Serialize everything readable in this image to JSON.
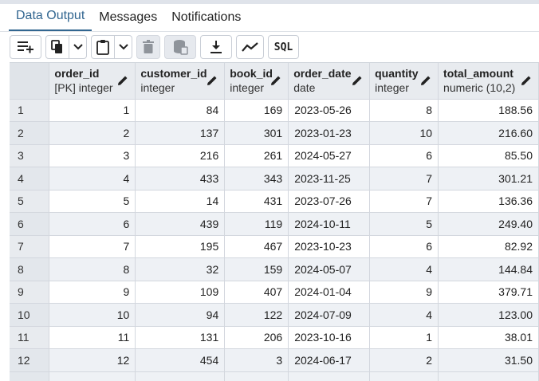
{
  "tabs": [
    {
      "label": "Data Output",
      "active": true
    },
    {
      "label": "Messages",
      "active": false
    },
    {
      "label": "Notifications",
      "active": false
    }
  ],
  "toolbar": {
    "sql_label": "SQL",
    "icons": [
      "add-row-icon",
      "copy-icon",
      "chevron-down-icon",
      "paste-icon",
      "chevron-down-icon",
      "delete-icon",
      "save-data-icon",
      "download-icon",
      "graph-icon",
      "sql-icon"
    ]
  },
  "columns": [
    {
      "name": "order_id",
      "type": "[PK] integer"
    },
    {
      "name": "customer_id",
      "type": "integer"
    },
    {
      "name": "book_id",
      "type": "integer"
    },
    {
      "name": "order_date",
      "type": "date"
    },
    {
      "name": "quantity",
      "type": "integer"
    },
    {
      "name": "total_amount",
      "type": "numeric (10,2)"
    }
  ],
  "rows": [
    {
      "rownum": "1",
      "cells": [
        "1",
        "84",
        "169",
        "2023-05-26",
        "8",
        "188.56"
      ]
    },
    {
      "rownum": "2",
      "cells": [
        "2",
        "137",
        "301",
        "2023-01-23",
        "10",
        "216.60"
      ]
    },
    {
      "rownum": "3",
      "cells": [
        "3",
        "216",
        "261",
        "2024-05-27",
        "6",
        "85.50"
      ]
    },
    {
      "rownum": "4",
      "cells": [
        "4",
        "433",
        "343",
        "2023-11-25",
        "7",
        "301.21"
      ]
    },
    {
      "rownum": "5",
      "cells": [
        "5",
        "14",
        "431",
        "2023-07-26",
        "7",
        "136.36"
      ]
    },
    {
      "rownum": "6",
      "cells": [
        "6",
        "439",
        "119",
        "2024-10-11",
        "5",
        "249.40"
      ]
    },
    {
      "rownum": "7",
      "cells": [
        "7",
        "195",
        "467",
        "2023-10-23",
        "6",
        "82.92"
      ]
    },
    {
      "rownum": "8",
      "cells": [
        "8",
        "32",
        "159",
        "2024-05-07",
        "4",
        "144.84"
      ]
    },
    {
      "rownum": "9",
      "cells": [
        "9",
        "109",
        "407",
        "2024-01-04",
        "9",
        "379.71"
      ]
    },
    {
      "rownum": "10",
      "cells": [
        "10",
        "94",
        "122",
        "2024-07-09",
        "4",
        "123.00"
      ]
    },
    {
      "rownum": "11",
      "cells": [
        "11",
        "131",
        "206",
        "2023-10-16",
        "1",
        "38.01"
      ]
    },
    {
      "rownum": "12",
      "cells": [
        "12",
        "454",
        "3",
        "2024-06-17",
        "2",
        "31.50"
      ]
    }
  ],
  "colors": {
    "accent": "#326690",
    "header_bg": "#e8ebef",
    "alt_row": "#eef1f5"
  }
}
